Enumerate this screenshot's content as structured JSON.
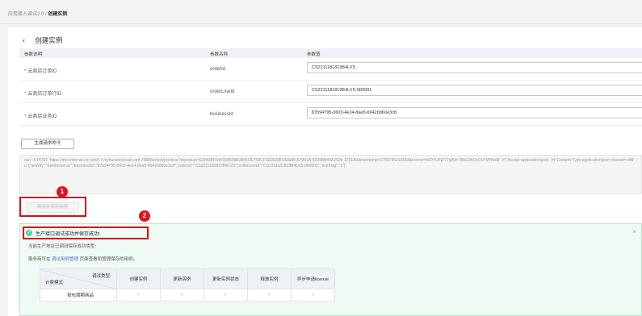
{
  "breadcrumb": {
    "parent": "应用接入调试2.0",
    "sep": "/",
    "current": "创建实例"
  },
  "page": {
    "back_icon": "‹",
    "title": "创建实例"
  },
  "params_table": {
    "headers": [
      "参数说明",
      "参数名称",
      "参数值"
    ],
    "rows": [
      {
        "required": "*",
        "label": "云商店订单ID",
        "name": "orderId",
        "value": "CS2211181819B4LVS"
      },
      {
        "required": "*",
        "label": "云商店订单行ID",
        "name": "orderLineId",
        "value": "CS2211181819B4LVS-000001"
      },
      {
        "required": "*",
        "label": "云商店业务ID",
        "name": "businessId",
        "value": "87b94795-0603-4e24-8ae5-69420d60e3c8"
      }
    ]
  },
  "generate_button": "生成请求命令",
  "curl_command": "curl -X POST 'https://ims-internal.cn-north-7.myhuaweicloud.com:7088/isvtest/produce?signature=ED4DBF54F008858B3845CE769CF1EDE6801E8A8157901A7DD9BB49A2624 1F5EA&timestamp=1700735210183&nonce=heDYUFjFT7qI5im f9bLDhOxOvTMH5s8l' -H 'Accept:application/json' -H 'Content-Type:application/json;charset=utf8' -d '{\"activity\":\"newInstance\",\"businessId\":\"87b94795-0603-4e24-8ae5-69420d60e3c8\",\"orderId\":\"CS2211181819B4LVS\",\"orderLineId\":\"CS2211181819B4LVS-000001\",\"testFlag\":\"1\"}'",
  "debug_button": "调测并保存用例",
  "annotations": {
    "badge1": "1",
    "badge2": "2"
  },
  "success": {
    "icon": "✓",
    "message": "生产接口调试成功并保存成功!",
    "close": "×",
    "line1": "当前生产地址已调测保存成功类型:",
    "line2_prefix": "服务商可在",
    "line2_link": "调试用例管理",
    "line2_suffix": "页面查看和管理保存的用例。"
  },
  "result_table": {
    "corner_top": "调试类型",
    "corner_bottom": "计费模式",
    "columns": [
      "创建实例",
      "更新实例",
      "更新实例状态",
      "释放实例",
      "异步申请license"
    ],
    "rows": [
      {
        "label": "按包周期商品",
        "cells": [
          "✓",
          "✓",
          "✓",
          "✓",
          "✓"
        ]
      }
    ]
  }
}
